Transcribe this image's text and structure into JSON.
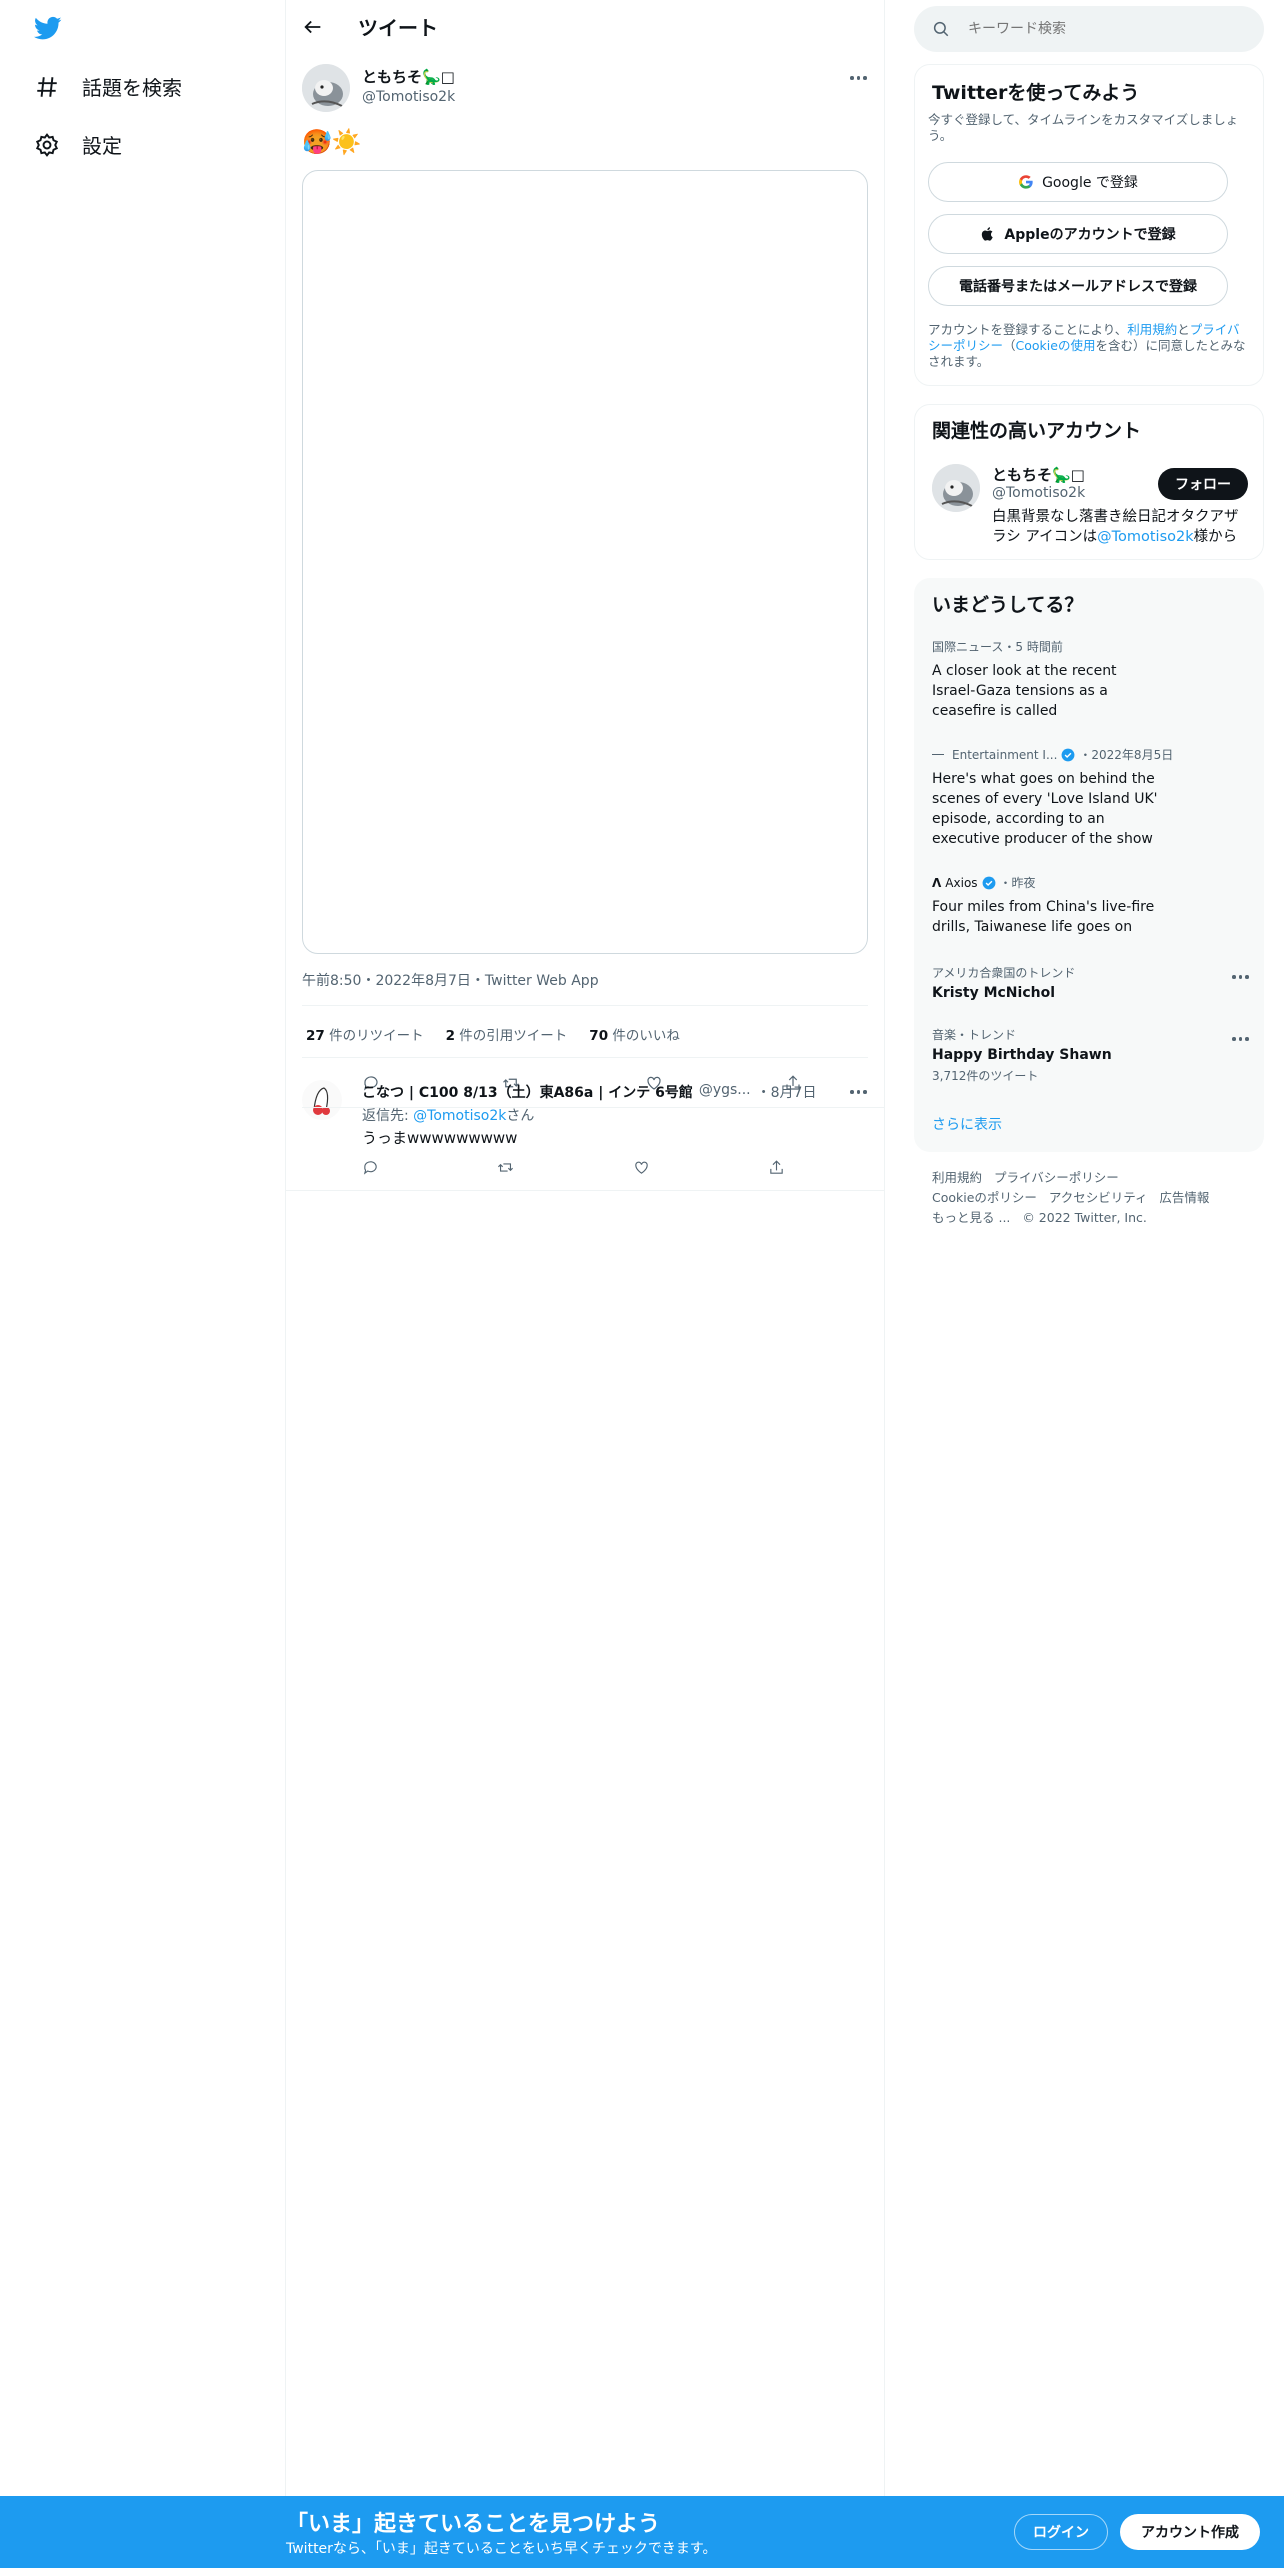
{
  "nav": {
    "logo_icon": "twitter-bird-icon",
    "items": [
      {
        "label": "話題を検索",
        "icon": "hashtag-icon"
      },
      {
        "label": "設定",
        "icon": "gear-icon"
      }
    ]
  },
  "header": {
    "title": "ツイート",
    "back_icon": "arrow-left-icon"
  },
  "tweet": {
    "name": "ともちそ🦕□",
    "handle": "@Tomotiso2k",
    "emoji_text": "🥵☀️",
    "meta": "午前8:50・2022年8月7日・Twitter Web App",
    "retweets_count": "27",
    "retweets_label": "件のリツイート",
    "quotes_count": "2",
    "quotes_label": "件の引用ツイート",
    "likes_count": "70",
    "likes_label": "件のいいね"
  },
  "reply": {
    "name": "こなつ | C100 8/13（土）東A86a | インテ 6号館",
    "handle": "@ygs...",
    "date": "・8月7日",
    "reply_to_prefix": "返信先: ",
    "reply_to_handle": "@Tomotiso2k",
    "reply_to_suffix": "さん",
    "text": "うっまwwwwwwwww"
  },
  "search": {
    "placeholder": "キーワード検索"
  },
  "signup": {
    "title": "Twitterを使ってみよう",
    "subtitle": "今すぐ登録して、タイムラインをカスタマイズしましょう。",
    "google_label": "Google で登録",
    "apple_label": "Appleのアカウントで登録",
    "phone_label": "電話番号またはメールアドレスで登録",
    "terms_prefix": "アカウントを登録することにより、",
    "terms_link": "利用規約",
    "terms_mid": "と",
    "privacy_link": "プライバシーポリシー",
    "cookie_pre": "（",
    "cookie_link": "Cookieの使用",
    "terms_suffix": "を含む）に同意したとみなされます。"
  },
  "related": {
    "title": "関連性の高いアカウント",
    "name": "ともちそ🦕□",
    "handle": "@Tomotiso2k",
    "follow_label": "フォロー",
    "bio_prefix": "白黒背景なし落書き絵日記オタクアザラシ アイコンは",
    "bio_link": "@Tomotiso2k",
    "bio_suffix": "様から"
  },
  "trends": {
    "title": "いまどうしてる？",
    "items": [
      {
        "category": "国際ニュース・5 時間前",
        "title": "A closer look at the recent Israel-Gaza tensions as a ceasefire is called"
      },
      {
        "source": "Entertainment I...",
        "time": "・2022年8月5日",
        "title": "Here's what goes on behind the scenes of every 'Love Island UK' episode, according to an executive producer of the show"
      },
      {
        "source": "Axios",
        "time": "・昨夜",
        "title": "Four miles from China's live-fire drills, Taiwanese life goes on"
      },
      {
        "category": "アメリカ合衆国のトレンド",
        "title": "Kristy McNichol"
      },
      {
        "category": "音楽・トレンド",
        "title": "Happy Birthday Shawn",
        "count": "3,712件のツイート"
      }
    ],
    "show_more": "さらに表示"
  },
  "footer": {
    "links": [
      "利用規約",
      "プライバシーポリシー",
      "Cookieのポリシー",
      "アクセシビリティ",
      "広告情報",
      "もっと見る ..."
    ],
    "copyright": "© 2022 Twitter, Inc."
  },
  "banner": {
    "title": "「いま」起きていることを見つけよう",
    "subtitle": "Twitterなら、「いま」起きていることをいち早くチェックできます。",
    "login_label": "ログイン",
    "signup_label": "アカウント作成"
  },
  "colors": {
    "accent": "#1d9bf0",
    "text": "#0f1419",
    "muted": "#536471",
    "border": "#eff3f4"
  }
}
